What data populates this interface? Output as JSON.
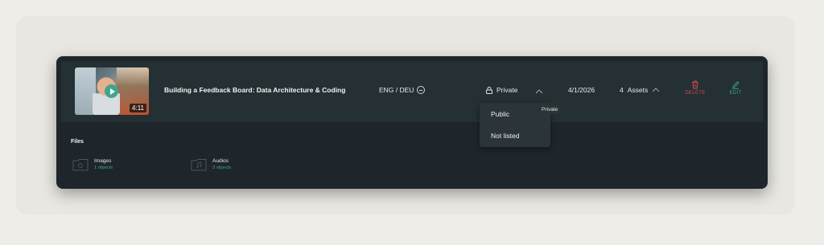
{
  "video": {
    "duration": "4:11",
    "title": "Building a Feedback Board: Data Architecture & Coding",
    "language": "ENG / DEU",
    "privacy": "Private",
    "date": "4/1/2026",
    "assets_count": "4",
    "assets_label": "Assets"
  },
  "actions": {
    "delete_label": "DELETE",
    "edit_label": "EDIT"
  },
  "tooltip": "Private",
  "privacy_dropdown": {
    "options": [
      "Public",
      "Not listed"
    ]
  },
  "files": {
    "heading": "Files",
    "folders": [
      {
        "name": "Images",
        "count": "1 objects",
        "icon": "image-folder-icon"
      },
      {
        "name": "Audios",
        "count": "3 objects",
        "icon": "audio-folder-icon"
      }
    ]
  },
  "colors": {
    "accent": "#3fa58f",
    "danger": "#d14a4a",
    "panel": "#1e262c",
    "row": "#243033"
  }
}
